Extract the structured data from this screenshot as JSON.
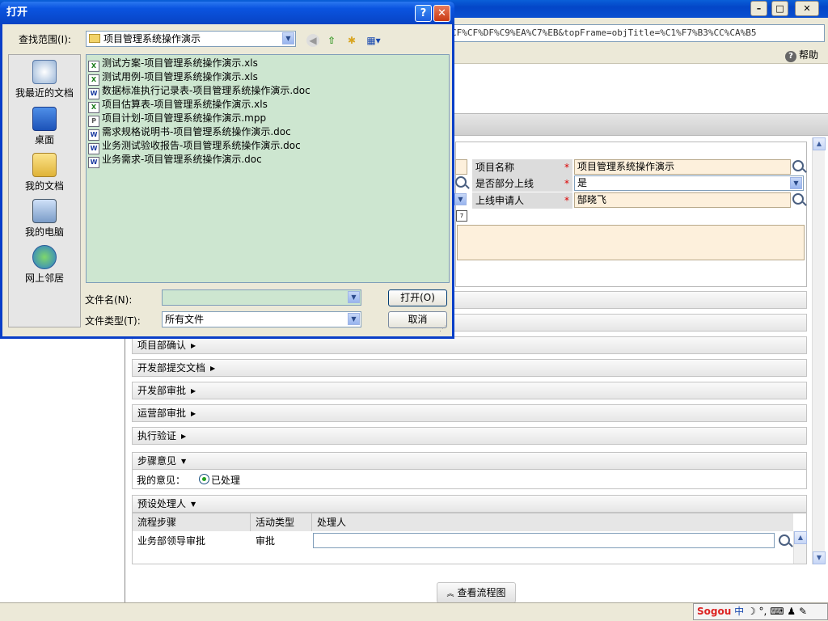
{
  "dialog": {
    "title": "打开",
    "help_glyph": "?",
    "close_glyph": "✕",
    "lookin_label": "查找范围(I):",
    "lookin_value": "项目管理系统操作演示",
    "places": [
      "我最近的文档",
      "桌面",
      "我的文档",
      "我的电脑",
      "网上邻居"
    ],
    "files": [
      {
        "name": "测试方案-项目管理系统操作演示.xls",
        "type": "xls"
      },
      {
        "name": "测试用例-项目管理系统操作演示.xls",
        "type": "xls"
      },
      {
        "name": "数据标准执行记录表-项目管理系统操作演示.doc",
        "type": "doc"
      },
      {
        "name": "项目估算表-项目管理系统操作演示.xls",
        "type": "xls"
      },
      {
        "name": "项目计划-项目管理系统操作演示.mpp",
        "type": "mpp"
      },
      {
        "name": "需求规格说明书-项目管理系统操作演示.doc",
        "type": "doc"
      },
      {
        "name": "业务测试验收报告-项目管理系统操作演示.doc",
        "type": "doc"
      },
      {
        "name": "业务需求-项目管理系统操作演示.doc",
        "type": "doc"
      }
    ],
    "filename_label": "文件名(N):",
    "filename_value": "",
    "filetype_label": "文件类型(T):",
    "filetype_value": "所有文件",
    "open_button": "打开(O)",
    "cancel_button": "取消"
  },
  "browser": {
    "address": "CF%CF%DF%C9%EA%C7%EB&topFrame=objTitle=%C1%F7%B3%CC%CA%B5",
    "help_label": "帮助",
    "min_glyph": "–",
    "max_glyph": "□",
    "close_glyph": "✕"
  },
  "form": {
    "project_name_label": "项目名称",
    "project_name_value": "项目管理系统操作演示",
    "partial_label": "是否部分上线",
    "partial_value": "是",
    "applicant_label": "上线申请人",
    "applicant_value": "郜晓飞",
    "required_mark": "*"
  },
  "sections": [
    "项目部确认",
    "开发部提交文档",
    "开发部审批",
    "运营部审批",
    "执行验证"
  ],
  "opinion": {
    "header": "步骤意见",
    "my_opinion_label": "我的意见：",
    "radio_label": "已处理"
  },
  "handlers": {
    "header": "预设处理人",
    "columns": [
      "流程步骤",
      "活动类型",
      "处理人"
    ],
    "rows": [
      {
        "step": "业务部领导审批",
        "type": "审批",
        "handler": ""
      }
    ]
  },
  "flow_button": "查看流程图",
  "ime": {
    "brand": "Sogou",
    "mode": "中"
  }
}
